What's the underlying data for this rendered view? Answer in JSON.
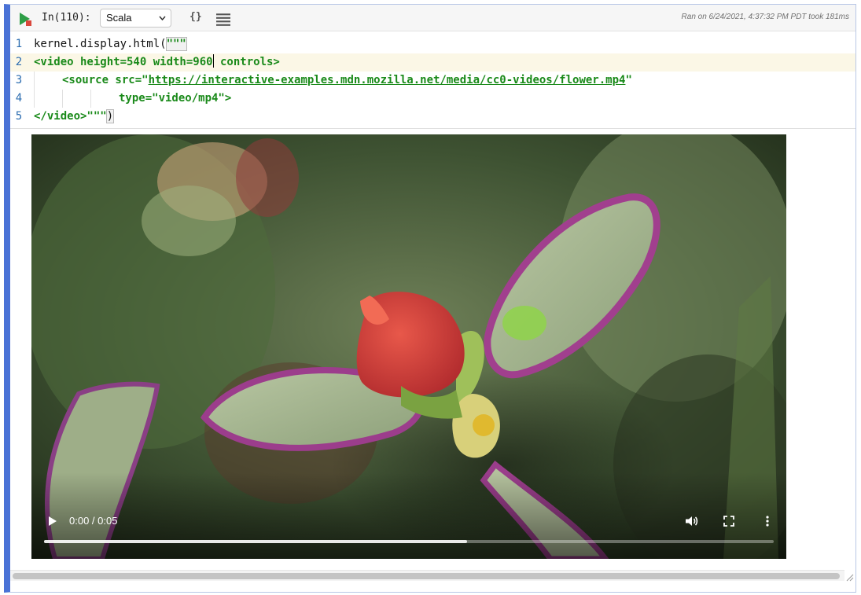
{
  "toolbar": {
    "prompt": "In(110):",
    "language": "Scala",
    "braces_icon_text": "{}",
    "ran_text": "Ran on 6/24/2021, 4:37:32 PM PDT took 181ms"
  },
  "editor": {
    "line_numbers": [
      "1",
      "2",
      "3",
      "4",
      "5"
    ],
    "line1": {
      "code": "kernel.display.html(",
      "quotes": "\"\"\""
    },
    "line2": {
      "code_before_cursor": "<video height=540 width=960",
      "code_after_cursor": " controls>"
    },
    "line3": {
      "prefix": "<source src=\"",
      "url": "https://interactive-examples.mdn.mozilla.net/media/cc0-videos/flower.mp4",
      "suffix": "\""
    },
    "line4": {
      "code": "type=\"video/mp4\">"
    },
    "line5": {
      "code": "</video>\"\"\"",
      "paren": ")"
    }
  },
  "video": {
    "time": "0:00 / 0:05",
    "progress_fraction": 0.58
  },
  "colors": {
    "accent_border": "#4a72d6",
    "code_tag": "#1a8a1a",
    "line_number": "#2b6cb0"
  },
  "icons": [
    "run-icon",
    "braces-icon",
    "menu-lines-icon",
    "chevron-down-icon",
    "play-icon",
    "volume-icon",
    "fullscreen-icon",
    "more-vertical-icon",
    "resize-icon"
  ]
}
